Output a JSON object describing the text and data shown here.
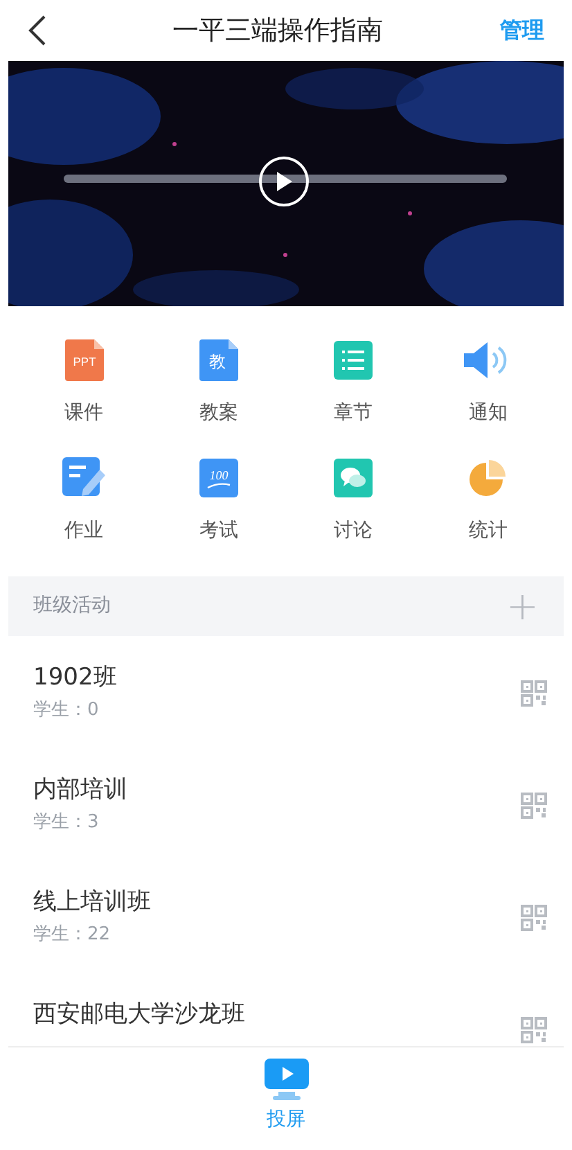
{
  "header": {
    "title": "一平三端操作指南",
    "action": "管理"
  },
  "tools": [
    {
      "kind": "ppt",
      "label": "课件",
      "icon_text": "PPT"
    },
    {
      "kind": "doc",
      "label": "教案",
      "icon_text": "教"
    },
    {
      "kind": "list",
      "label": "章节"
    },
    {
      "kind": "speaker",
      "label": "通知"
    },
    {
      "kind": "edit",
      "label": "作业"
    },
    {
      "kind": "score",
      "label": "考试",
      "icon_text": "100"
    },
    {
      "kind": "chat",
      "label": "讨论"
    },
    {
      "kind": "pie",
      "label": "统计"
    }
  ],
  "section": {
    "title": "班级活动",
    "add": "+"
  },
  "classes": [
    {
      "name": "1902班",
      "students": "学生：0"
    },
    {
      "name": "内部培训",
      "students": "学生：3"
    },
    {
      "name": "线上培训班",
      "students": "学生：22"
    },
    {
      "name": "西安邮电大学沙龙班"
    }
  ],
  "bottom": {
    "label": "投屏"
  }
}
